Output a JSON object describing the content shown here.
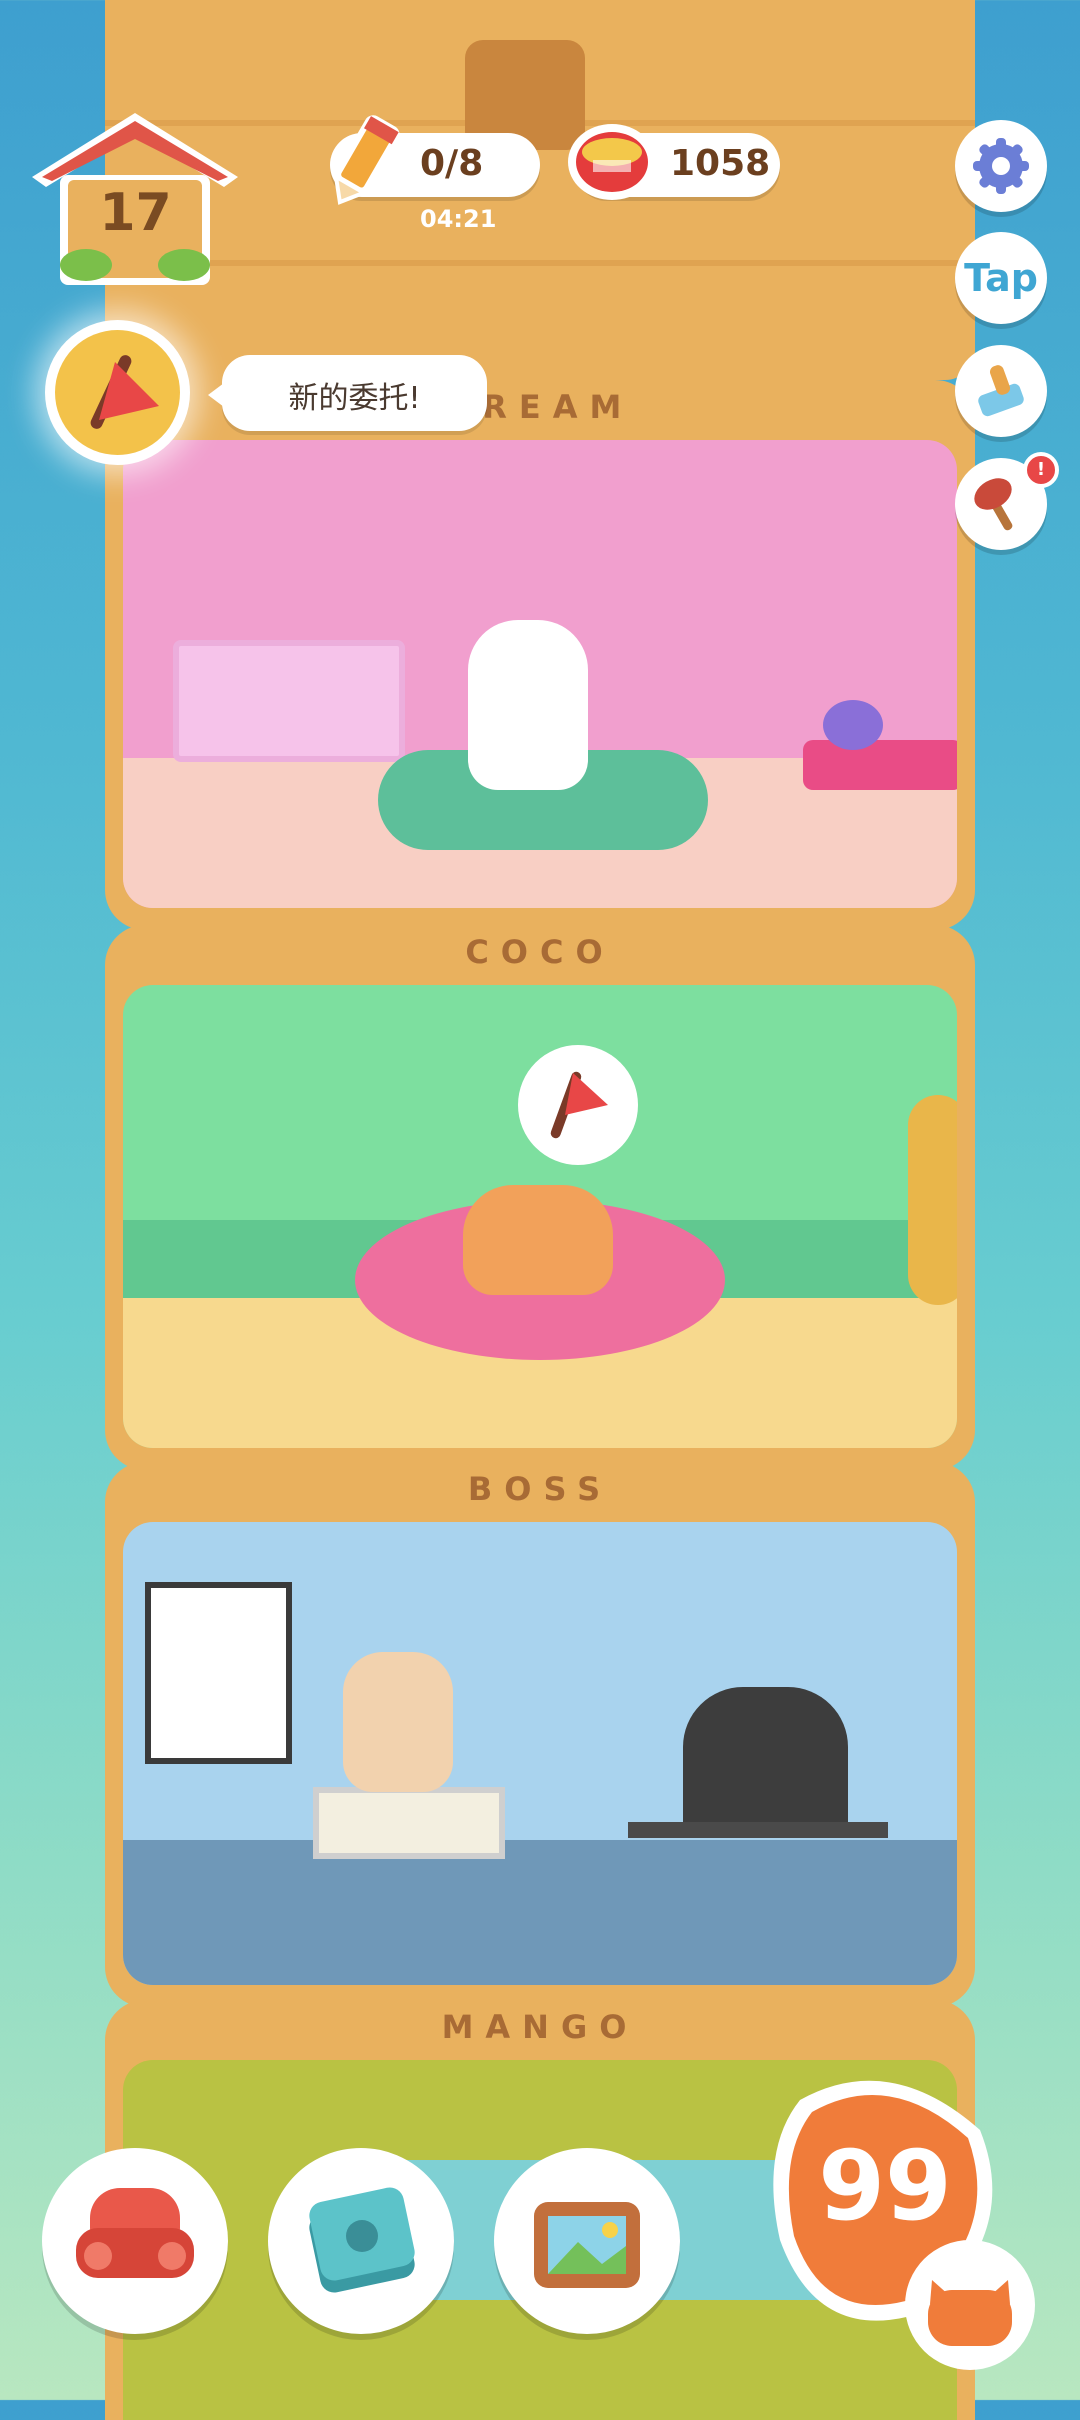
{
  "hud": {
    "house_level": "17",
    "requests_count": "0/8",
    "requests_timer": "04:21",
    "coins": "1058",
    "tap_label": "Tap"
  },
  "notification": {
    "speech": "新的委托!"
  },
  "floors": [
    {
      "name": "CREAM"
    },
    {
      "name": "COCO"
    },
    {
      "name": "BOSS"
    },
    {
      "name": "MANGO"
    }
  ],
  "bottom_bar": {
    "points": "99"
  },
  "icons": {
    "settings": "gear-icon",
    "tap": "tap-icon",
    "paint": "paint-brush-icon",
    "plunger": "plunger-icon",
    "furniture": "armchair-icon",
    "catbook": "paw-notebook-icon",
    "gallery": "picture-frame-icon",
    "request": "pencil-icon",
    "coin": "tuna-can-icon"
  },
  "colors": {
    "wood": "#e9b15e",
    "accent_orange": "#f07c3a",
    "text_brown": "#6b3f1f"
  }
}
